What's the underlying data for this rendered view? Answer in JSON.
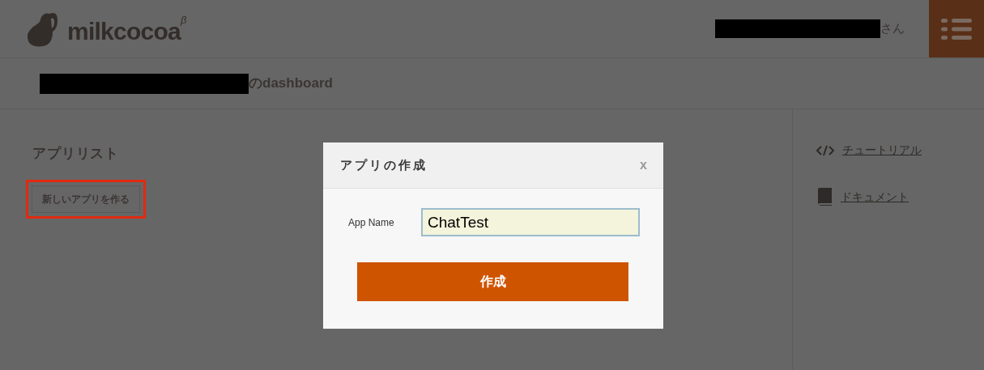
{
  "header": {
    "logo": {
      "text": "milkcocoa",
      "superscript": "β"
    },
    "user_suffix": "さん"
  },
  "page_title": {
    "suffix": "のdashboard"
  },
  "app_list": {
    "title": "アプリリスト",
    "create_button": {
      "label": "新しいアプリを作る",
      "highlighted": true
    }
  },
  "sidebar": {
    "links": [
      {
        "kind": "code",
        "label": "チュートリアル"
      },
      {
        "kind": "book",
        "label": "ドキュメント"
      }
    ]
  },
  "dialog": {
    "title": "アプリの作成",
    "close": "x",
    "field": {
      "label": "App Name",
      "value": "ChatTest"
    },
    "submit": "作成"
  }
}
